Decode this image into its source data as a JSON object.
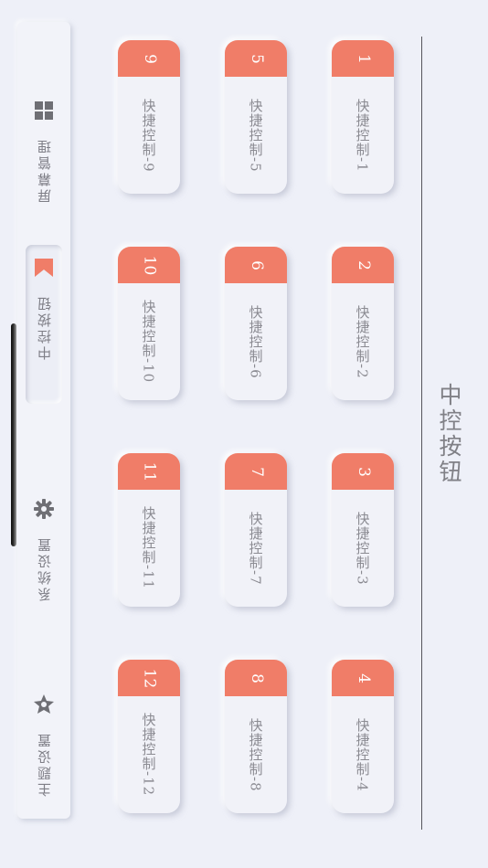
{
  "page_title": "中控按钮",
  "colors": {
    "accent": "#f07d68",
    "background": "#eef0f8",
    "text": "#8d8d93",
    "divider": "#56565c"
  },
  "sidebar": {
    "items": [
      {
        "label": "屏幕管理",
        "icon": "grid-icon",
        "active": false
      },
      {
        "label": "中控按钮",
        "icon": "mountain-icon",
        "active": true
      },
      {
        "label": "系统设置",
        "icon": "gear-icon",
        "active": false
      },
      {
        "label": "主题设置",
        "icon": "badge-icon",
        "active": false
      }
    ]
  },
  "quick_buttons": [
    {
      "number": "1",
      "label": "快捷控制-1"
    },
    {
      "number": "2",
      "label": "快捷控制-2"
    },
    {
      "number": "3",
      "label": "快捷控制-3"
    },
    {
      "number": "4",
      "label": "快捷控制-4"
    },
    {
      "number": "5",
      "label": "快捷控制-5"
    },
    {
      "number": "6",
      "label": "快捷控制-6"
    },
    {
      "number": "7",
      "label": "快捷控制-7"
    },
    {
      "number": "8",
      "label": "快捷控制-8"
    },
    {
      "number": "9",
      "label": "快捷控制-9"
    },
    {
      "number": "10",
      "label": "快捷控制-10"
    },
    {
      "number": "11",
      "label": "快捷控制-11"
    },
    {
      "number": "12",
      "label": "快捷控制-12"
    }
  ]
}
